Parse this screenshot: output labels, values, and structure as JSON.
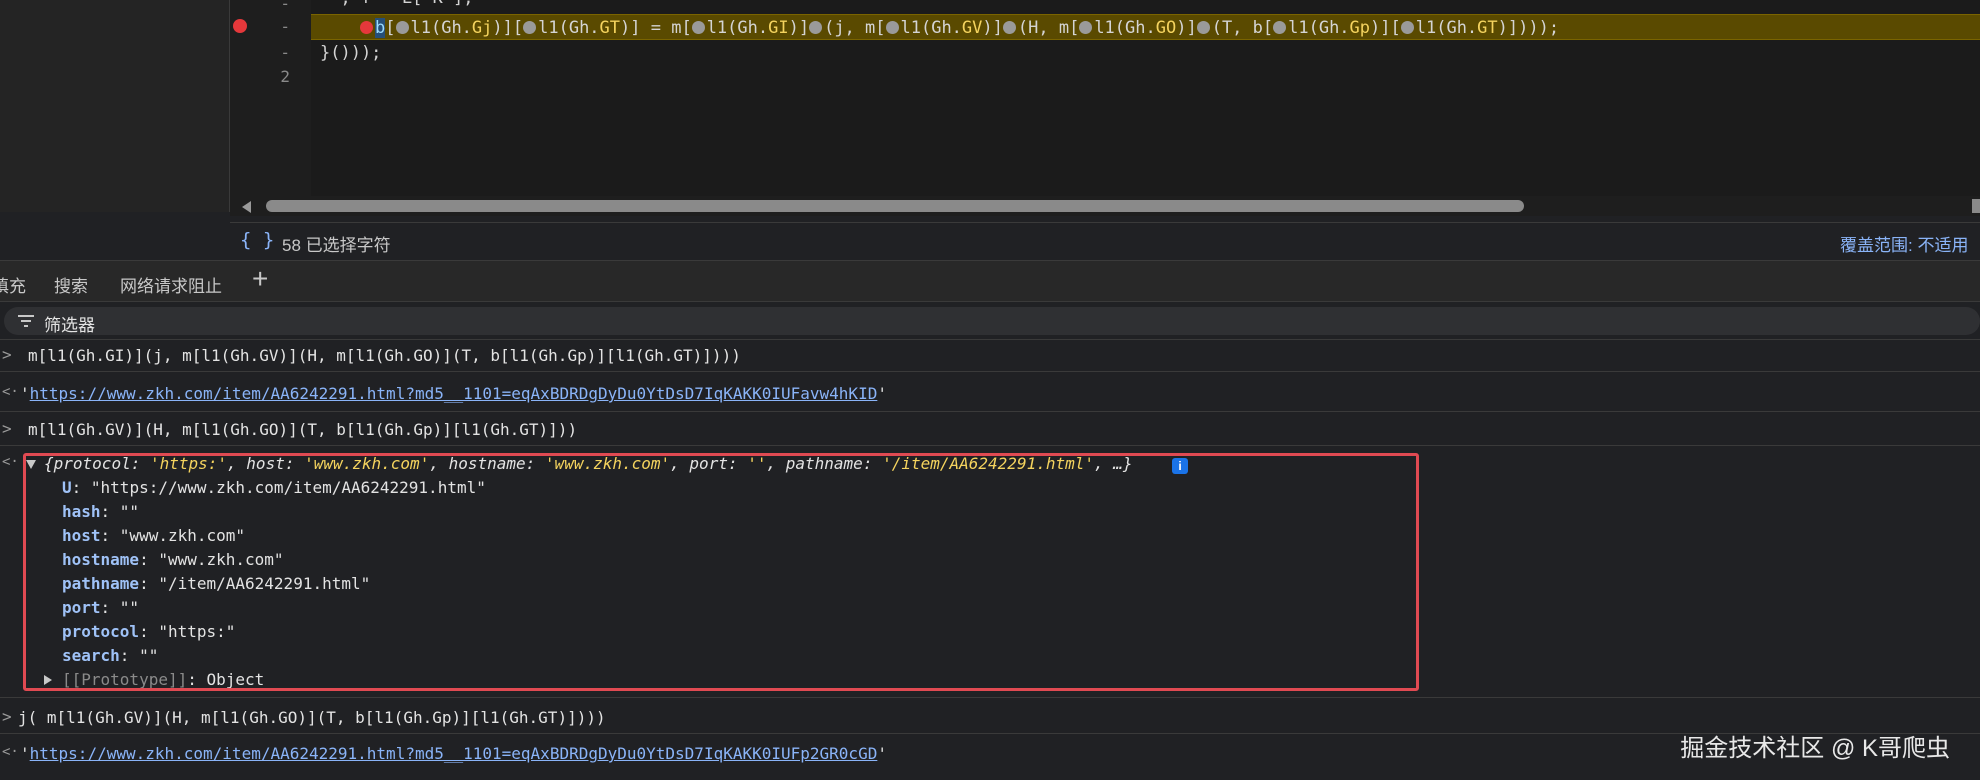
{
  "editor": {
    "partial_top_line": "  , f = L[ K ];",
    "line_number_minus_1": "-",
    "line_number_minus_2": "-",
    "line_number_minus_3": "-",
    "line_number_2": "2",
    "closing_line": "}()));"
  },
  "status": {
    "format_icon": "{ }",
    "selection_text": "58 已选择字符",
    "coverage_text": "覆盖范围: 不适用"
  },
  "drawer_tabs": [
    {
      "label": "填充"
    },
    {
      "label": "搜索"
    },
    {
      "label": "网络请求阻止"
    }
  ],
  "tab_add_label": "+",
  "filter": {
    "label": "筛选器"
  },
  "console": {
    "prompt_in": ">",
    "prompt_out": "<·",
    "msg1": "m[l1(Gh.GI)](j, m[l1(Gh.GV)](H, m[l1(Gh.GO)](T, b[l1(Gh.Gp)][l1(Gh.GT)])))",
    "result1_url": "https://www.zkh.com/item/AA6242291.html?md5__1101=eqAxBDRDgDyDu0YtDsD7IqKAKK0IUFavw4hKID",
    "msg2": "m[l1(Gh.GV)](H, m[l1(Gh.GO)](T, b[l1(Gh.Gp)][l1(Gh.GT)]))",
    "object_summary": {
      "protocol_key": "protocol",
      "protocol_val": "'https:'",
      "host_key": "host",
      "host_val": "'www.zkh.com'",
      "hostname_key": "hostname",
      "hostname_val": "'www.zkh.com'",
      "port_key": "port",
      "port_val": "''",
      "pathname_key": "pathname",
      "pathname_val": "'/item/AA6242291.html'",
      "ellipsis": ", …}"
    },
    "props": [
      {
        "key": "U",
        "value": "\"https://www.zkh.com/item/AA6242291.html\""
      },
      {
        "key": "hash",
        "value": "\"\""
      },
      {
        "key": "host",
        "value": "\"www.zkh.com\""
      },
      {
        "key": "hostname",
        "value": "\"www.zkh.com\""
      },
      {
        "key": "pathname",
        "value": "\"/item/AA6242291.html\""
      },
      {
        "key": "port",
        "value": "\"\""
      },
      {
        "key": "protocol",
        "value": "\"https:\""
      },
      {
        "key": "search",
        "value": "\"\""
      }
    ],
    "prototype_key": "[[Prototype]]",
    "prototype_val": "Object",
    "msg3": "j( m[l1(Gh.GV)](H, m[l1(Gh.GO)](T, b[l1(Gh.Gp)][l1(Gh.GT)])))",
    "result3_url": "https://www.zkh.com/item/AA6242291.html?md5__1101=eqAxBDRDgDyDu0YtDsD7IqKAKK0IUFp2GR0cGD"
  },
  "watermark": "掘金技术社区 @ K哥爬虫"
}
